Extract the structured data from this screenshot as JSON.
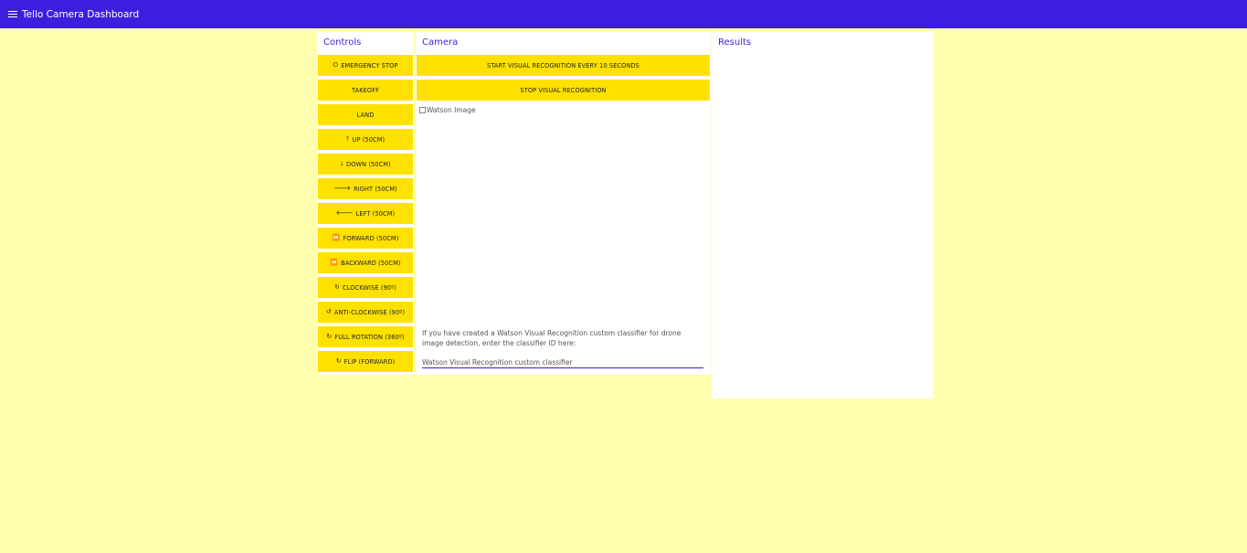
{
  "appbar": {
    "title": "Tello Camera Dashboard"
  },
  "controls": {
    "title": "Controls",
    "buttons": [
      {
        "label": "EMERGENCY STOP",
        "icon": "⭘"
      },
      {
        "label": "TAKEOFF",
        "icon": ""
      },
      {
        "label": "LAND",
        "icon": ""
      },
      {
        "label": "UP (50CM)",
        "icon": "🡑"
      },
      {
        "label": "DOWN (50CM)",
        "icon": "🡓"
      },
      {
        "label": "RIGHT (50CM)",
        "icon": "🡒"
      },
      {
        "label": "LEFT (50CM)",
        "icon": "🡐"
      },
      {
        "label": "FORWARD (50CM)",
        "icon": "⏩"
      },
      {
        "label": "BACKWARD (50CM)",
        "icon": "⏪"
      },
      {
        "label": "CLOCKWISE (90º)",
        "icon": "↻"
      },
      {
        "label": "ANTI-CLOCKWISE (90º)",
        "icon": "↺"
      },
      {
        "label": "FULL ROTATION (360º)",
        "icon": "↻"
      },
      {
        "label": "FLIP (FORWARD)",
        "icon": "↻"
      }
    ]
  },
  "camera": {
    "title": "Camera",
    "start_label": "START VISUAL RECOGNITION EVERY 10 SECONDS",
    "stop_label": "STOP VISUAL RECOGNITION",
    "image_alt": "Watson Image",
    "hint": "If you have created a Watson Visual Recognition custom classifier for drone image detection, enter the classifier ID here:",
    "classifier_placeholder": "Watson Visual Recognition custom classifier"
  },
  "results": {
    "title": "Results"
  },
  "colors": {
    "appbar": "#3f1ddf",
    "background": "#ffffad",
    "button": "#ffe100"
  }
}
